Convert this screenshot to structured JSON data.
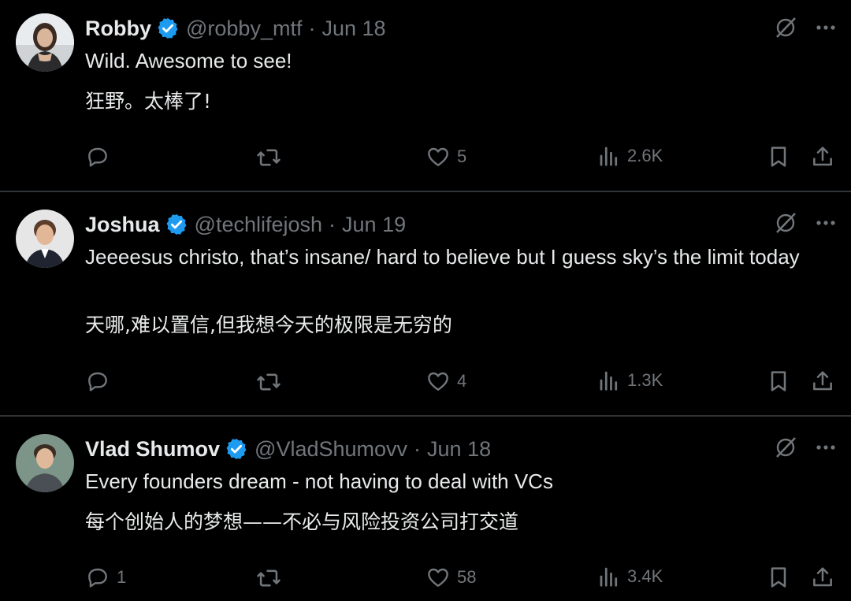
{
  "tweets": [
    {
      "name": "Robby",
      "handle": "@robby_mtf",
      "separator": "·",
      "date": "Jun 18",
      "text": "Wild. Awesome to see!",
      "translation": "狂野。太棒了!",
      "replies": "",
      "likes": "5",
      "views": "2.6K",
      "avatar_color": "#6b5a52"
    },
    {
      "name": "Joshua",
      "handle": "@techlifejosh",
      "separator": "·",
      "date": "Jun 19",
      "text": "Jeeeesus christo, that’s insane/ hard to believe but I guess sky’s the limit today",
      "translation": "天哪,难以置信,但我想今天的极限是无穷的",
      "replies": "",
      "likes": "4",
      "views": "1.3K",
      "avatar_color": "#d9d9d9"
    },
    {
      "name": "Vlad Shumov",
      "handle": "@VladShumovv",
      "separator": "·",
      "date": "Jun 18",
      "text": "Every founders dream - not having to deal with VCs",
      "translation": "每个创始人的梦想——不必与风险投资公司打交道",
      "replies": "1",
      "likes": "58",
      "views": "3.4K",
      "avatar_color": "#6f8a7a"
    }
  ],
  "icons": {
    "verified": "verified-badge-icon",
    "grok": "grok-icon",
    "more": "more-icon",
    "reply": "reply-icon",
    "retweet": "retweet-icon",
    "like": "heart-icon",
    "views": "views-icon",
    "bookmark": "bookmark-icon",
    "share": "share-icon"
  },
  "colors": {
    "background": "#000000",
    "text": "#e7e9ea",
    "muted": "#71767b",
    "verified": "#1d9bf0",
    "divider": "#2f3336"
  }
}
